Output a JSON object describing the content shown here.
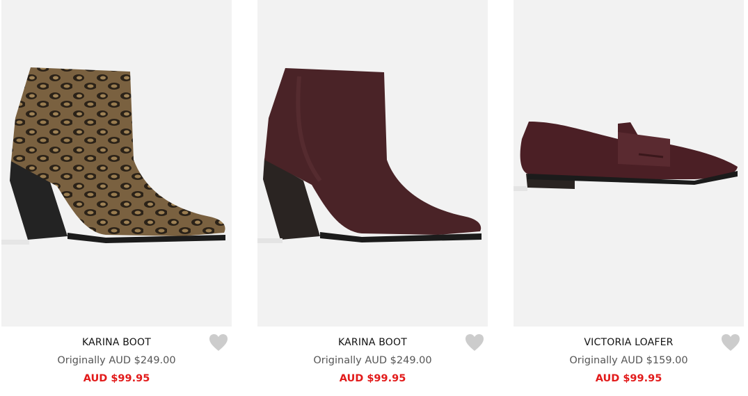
{
  "products": [
    {
      "name": "KARINA BOOT",
      "original_price": "Originally AUD $249.00",
      "sale_price": "AUD $99.95",
      "image": "snake-print-ankle-boot"
    },
    {
      "name": "KARINA BOOT",
      "original_price": "Originally AUD $249.00",
      "sale_price": "AUD $99.95",
      "image": "burgundy-leather-ankle-boot"
    },
    {
      "name": "VICTORIA LOAFER",
      "original_price": "Originally AUD $159.00",
      "sale_price": "AUD $99.95",
      "image": "burgundy-leather-loafer"
    }
  ],
  "icons": {
    "wishlist": "heart-icon"
  },
  "colors": {
    "sale_price": "#e21b1b",
    "original_price": "#555555",
    "image_background": "#f2f2f2",
    "heart": "#cccccc"
  }
}
